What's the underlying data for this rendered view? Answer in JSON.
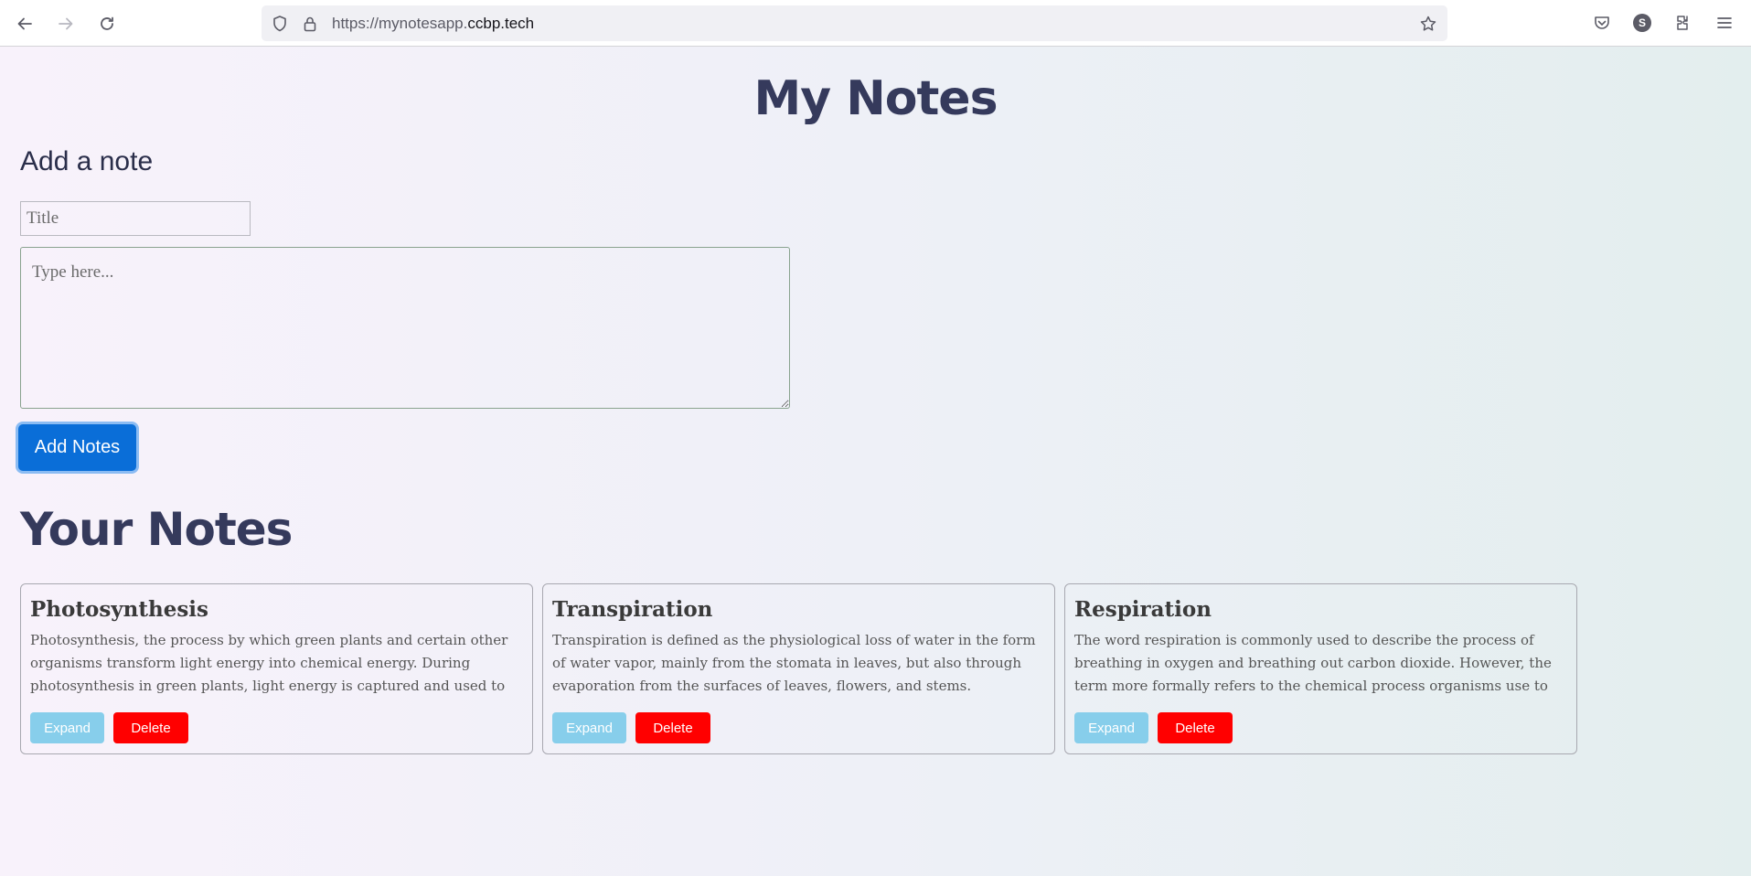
{
  "browser": {
    "url_prefix": "https://mynotesapp.",
    "url_host": "ccbp.tech",
    "avatar_letter": "S"
  },
  "page": {
    "title": "My Notes",
    "add_heading": "Add a note",
    "title_placeholder": "Title",
    "body_placeholder": "Type here...",
    "add_button": "Add Notes",
    "notes_heading": "Your Notes"
  },
  "notes": [
    {
      "title": "Photosynthesis",
      "body": "Photosynthesis, the process by which green plants and certain other organisms transform light energy into chemical energy. During photosynthesis in green plants, light energy is captured and used to",
      "expand": "Expand",
      "delete": "Delete"
    },
    {
      "title": "Transpiration",
      "body": "Transpiration is defined as the physiological loss of water in the form of water vapor, mainly from the stomata in leaves, but also through evaporation from the surfaces of leaves, flowers, and stems.",
      "expand": "Expand",
      "delete": "Delete"
    },
    {
      "title": "Respiration",
      "body": "The word respiration is commonly used to describe the process of breathing in oxygen and breathing out carbon dioxide. However, the term more formally refers to the chemical process organisms use to release the",
      "expand": "Expand",
      "delete": "Delete"
    }
  ],
  "colors": {
    "heading": "#353a5c",
    "primary_button": "#0a6ed8",
    "expand_button": "#87ceeb",
    "delete_button": "#ff0000"
  },
  "icons": [
    "back-arrow-icon",
    "forward-arrow-icon",
    "reload-icon",
    "shield-icon",
    "lock-icon",
    "star-icon",
    "pocket-icon",
    "account-icon",
    "extensions-icon",
    "menu-icon"
  ]
}
